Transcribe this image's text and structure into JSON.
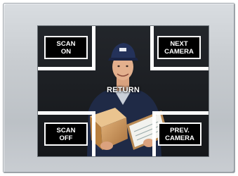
{
  "controls": {
    "scan_on": "SCAN\nON",
    "next_camera": "NEXT\nCAMERA",
    "return": "RETURN",
    "scan_off": "SCAN\nOFF",
    "prev_camera": "PREV.\nCAMERA"
  },
  "colors": {
    "bezel": "#c8ccd0",
    "screen": "#1a1c20",
    "button_bg": "#000000",
    "button_border": "#ffffff",
    "text": "#ffffff"
  }
}
